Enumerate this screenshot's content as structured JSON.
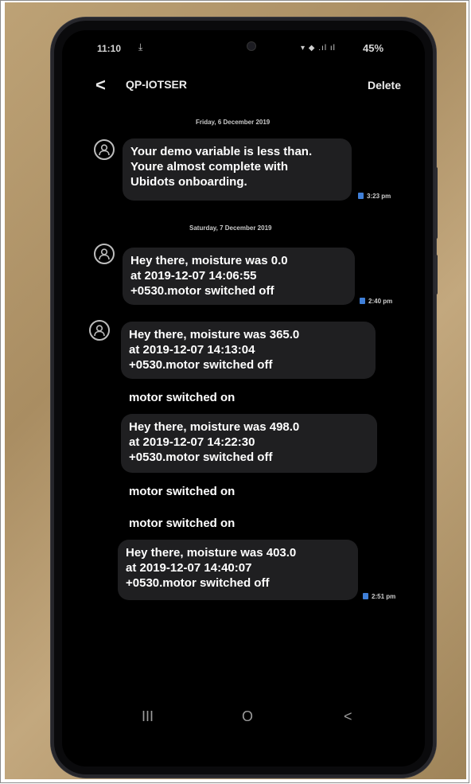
{
  "status_bar": {
    "time": "11:10",
    "download_icon": "⤓",
    "signal_icons": "▾ ◆ .ıl ıl",
    "battery": "45%"
  },
  "header": {
    "back_icon": "<",
    "title": "QP-IOTSER",
    "delete_label": "Delete"
  },
  "dates": [
    "Friday, 6 December 2019",
    "Saturday, 7 December 2019"
  ],
  "messages": [
    {
      "text": "Your demo variable is less than.\nYoure almost complete with\nUbidots onboarding.",
      "time": "3:23 pm"
    },
    {
      "text": "Hey there, moisture was 0.0\nat 2019-12-07 14:06:55\n+0530.motor switched off",
      "time": "2:40 pm"
    },
    {
      "text": "Hey there, moisture was 365.0\nat 2019-12-07 14:13:04\n+0530.motor switched off"
    },
    {
      "text": "motor switched on"
    },
    {
      "text": "Hey there, moisture was 498.0\nat 2019-12-07 14:22:30\n+0530.motor switched off"
    },
    {
      "text": "motor switched on"
    },
    {
      "text": "motor switched on"
    },
    {
      "text": "Hey there, moisture was 403.0\nat 2019-12-07 14:40:07\n+0530.motor switched off",
      "time": "2:51 pm"
    }
  ],
  "nav": {
    "recents_icon": "III",
    "home_icon": "O",
    "back_icon": "<"
  },
  "colors": {
    "screen_background": "#000000",
    "bubble_background": "#1f1f21",
    "sim_badge": "#3f7fd8",
    "table_wood": "#b49a6e"
  }
}
